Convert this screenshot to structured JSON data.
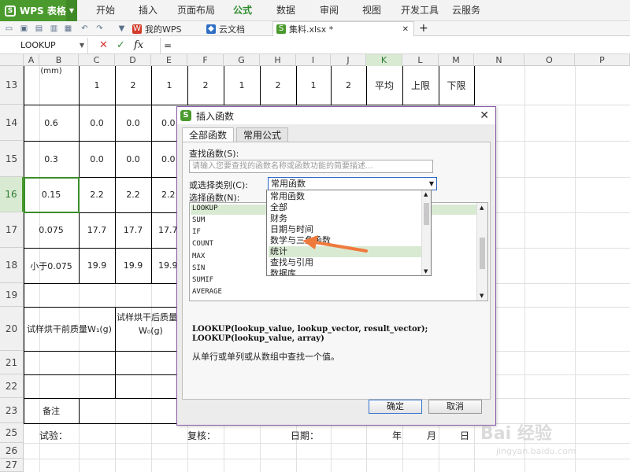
{
  "app": {
    "name": "WPS 表格"
  },
  "menu": [
    "开始",
    "插入",
    "页面布局",
    "公式",
    "数据",
    "审阅",
    "视图",
    "开发工具",
    "云服务"
  ],
  "menu_active": "公式",
  "tabs": {
    "my_wps": "我的WPS",
    "cloud_docs": "云文档",
    "file": "集料.xlsx *",
    "add": "+"
  },
  "formula_bar": {
    "name_box": "LOOKUP",
    "value": "=",
    "fx": "fx",
    "cancel": "✕",
    "confirm": "✓"
  },
  "columns": [
    "A",
    "B",
    "C",
    "D",
    "E",
    "F",
    "G",
    "H",
    "I",
    "J",
    "K",
    "L",
    "M",
    "N",
    "O",
    "P"
  ],
  "rows": [
    "13",
    "14",
    "15",
    "16",
    "17",
    "18",
    "19",
    "20",
    "21",
    "22",
    "23",
    "25",
    "26",
    "27"
  ],
  "sheet": {
    "r13": {
      "a": "(mm)",
      "c": "1",
      "d": "2",
      "e": "1",
      "f": "2",
      "g": "1",
      "h": "2",
      "i": "1",
      "j": "2",
      "k": "平均",
      "l": "上限",
      "m": "下限"
    },
    "r14": {
      "a": "0.6",
      "c": "0.0",
      "d": "0.0",
      "e": "0.0"
    },
    "r15": {
      "a": "0.3",
      "c": "0.0",
      "d": "0.0",
      "e": "0.0"
    },
    "r16": {
      "a": "0.15",
      "c": "2.2",
      "d": "2.2",
      "e": "2.2"
    },
    "r17": {
      "a": "0.075",
      "c": "17.7",
      "d": "17.7",
      "e": "17.7"
    },
    "r18": {
      "a": "小于0.075",
      "c": "19.9",
      "d": "19.9",
      "e": "19.9"
    },
    "r20": {
      "a": "试样烘干前质量W₁(g)",
      "b1": "试样烘干后质量",
      "b2": "W₀(g)"
    },
    "r23": {
      "a": "备注"
    },
    "r25": {
      "a": "试验：",
      "b": "复核：",
      "c": "日期：",
      "y": "年",
      "m": "月",
      "d": "日"
    }
  },
  "dialog": {
    "title": "插入函数",
    "close": "✕",
    "tab_all": "全部函数",
    "tab_common": "常用公式",
    "search_label": "查找函数(S):",
    "search_placeholder": "请输入您要查找的函数名称或函数功能的简要描述...",
    "category_label": "或选择类别(C):",
    "category_selected": "常用函数",
    "function_label": "选择函数(N):",
    "functions": [
      "LOOKUP",
      "SUM",
      "IF",
      "COUNT",
      "MAX",
      "SIN",
      "SUMIF",
      "AVERAGE"
    ],
    "categories": [
      "常用函数",
      "全部",
      "财务",
      "日期与时间",
      "数学与三角函数",
      "统计",
      "查找与引用",
      "数据库"
    ],
    "category_highlighted": "统计",
    "syntax_line1": "LOOKUP(lookup_value, lookup_vector, result_vector);",
    "syntax_line2": "LOOKUP(lookup_value, array)",
    "description": "从单行或单列或从数组中查找一个值。",
    "ok": "确定",
    "cancel": "取消"
  },
  "watermark": {
    "line1": "Bai 经验",
    "line2": "jingyan.baidu.com"
  },
  "colors": {
    "brand_green": "#4a9a2d",
    "arrow": "#f07a3c",
    "dialog_border": "#8a5aa8"
  }
}
